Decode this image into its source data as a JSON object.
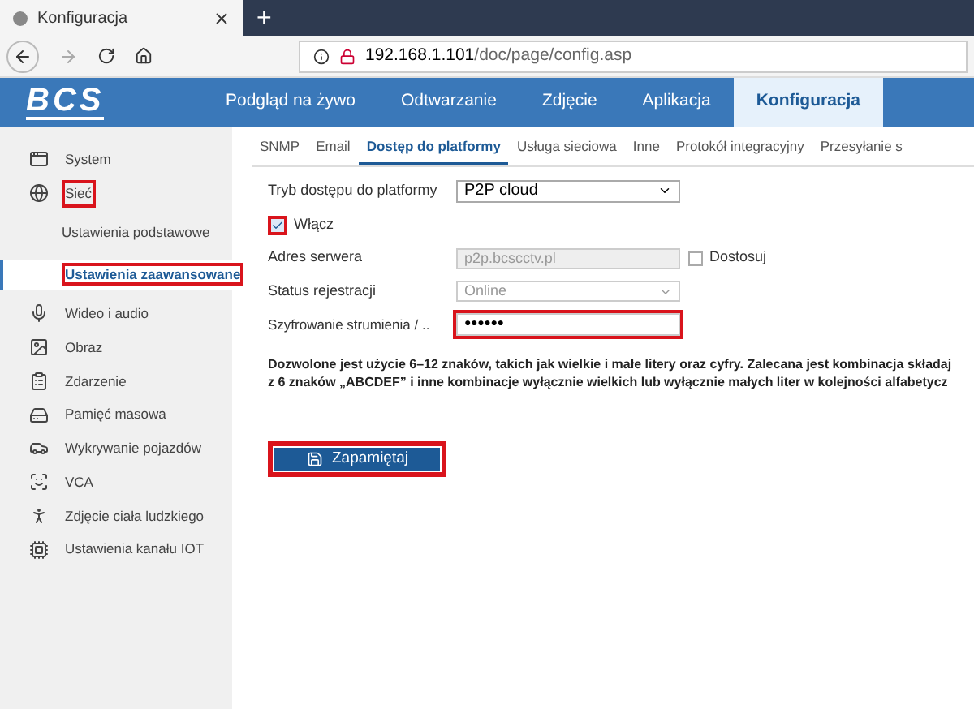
{
  "browser": {
    "tab_title": "Konfiguracja",
    "new_tab": "+",
    "address_host": "192.168.1.101",
    "address_path": "/doc/page/config.asp"
  },
  "logo": "BCS",
  "nav": [
    {
      "label": "Podgląd na żywo",
      "selected": false
    },
    {
      "label": "Odtwarzanie",
      "selected": false
    },
    {
      "label": "Zdjęcie",
      "selected": false
    },
    {
      "label": "Aplikacja",
      "selected": false
    },
    {
      "label": "Konfiguracja",
      "selected": true
    }
  ],
  "sidebar": {
    "items": [
      {
        "label": "System",
        "kind": "system",
        "selected": false,
        "highlighted": false
      },
      {
        "label": "Sieć",
        "kind": "network",
        "selected": false,
        "highlighted": true,
        "children": [
          {
            "label": "Ustawienia podstawowe",
            "selected": false,
            "highlighted": false
          },
          {
            "label": "Ustawienia zaawansowane",
            "selected": true,
            "highlighted": true
          }
        ]
      },
      {
        "label": "Wideo i audio",
        "kind": "video",
        "selected": false,
        "highlighted": false
      },
      {
        "label": "Obraz",
        "kind": "image",
        "selected": false,
        "highlighted": false
      },
      {
        "label": "Zdarzenie",
        "kind": "event",
        "selected": false,
        "highlighted": false
      },
      {
        "label": "Pamięć masowa",
        "kind": "storage",
        "selected": false,
        "highlighted": false
      },
      {
        "label": "Wykrywanie pojazdów",
        "kind": "vehicle",
        "selected": false,
        "highlighted": false
      },
      {
        "label": "VCA",
        "kind": "vca",
        "selected": false,
        "highlighted": false
      },
      {
        "label": "Zdjęcie ciała ludzkiego",
        "kind": "body",
        "selected": false,
        "highlighted": false
      },
      {
        "label": "Ustawienia kanału IOT",
        "kind": "iot",
        "selected": false,
        "highlighted": false
      }
    ]
  },
  "tabs": [
    {
      "label": "SNMP",
      "selected": false
    },
    {
      "label": "Email",
      "selected": false
    },
    {
      "label": "Dostęp do platformy",
      "selected": true
    },
    {
      "label": "Usługa sieciowa",
      "selected": false
    },
    {
      "label": "Inne",
      "selected": false
    },
    {
      "label": "Protokół integracyjny",
      "selected": false
    },
    {
      "label": "Przesyłanie s",
      "selected": false
    }
  ],
  "form": {
    "mode": {
      "label": "Tryb dostępu do platformy",
      "value": "P2P cloud"
    },
    "enable": {
      "label": "Włącz",
      "checked": true,
      "highlighted": true
    },
    "server": {
      "label": "Adres serwera",
      "value": "p2p.bcscctv.pl",
      "custom_label": "Dostosuj",
      "custom_checked": false
    },
    "status": {
      "label": "Status rejestracji",
      "value": "Online"
    },
    "encryption": {
      "label": "Szyfrowanie strumienia / ..",
      "value": "●●●●●●",
      "highlighted": true
    },
    "hint_lines": [
      "Dozwolone jest użycie 6–12 znaków, takich jak wielkie i małe litery oraz cyfry. Zalecana jest kombinacja składaj",
      "z 6 znaków „ABCDEF” i inne kombinacje wyłącznie wielkich lub wyłącznie małych liter w kolejności alfabetycz"
    ],
    "save": {
      "label": "Zapamiętaj",
      "highlighted": true
    }
  }
}
